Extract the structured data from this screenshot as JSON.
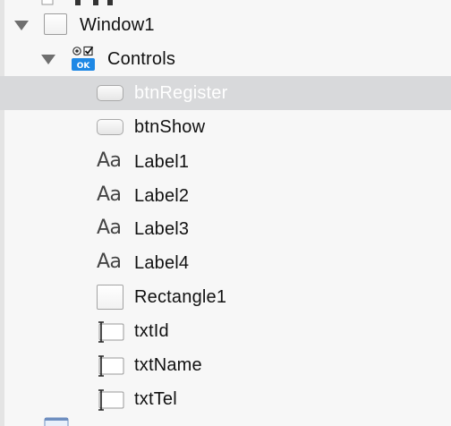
{
  "tree": {
    "rows": [
      {
        "label": "Window1",
        "icon": "window-icon",
        "expanded": true
      },
      {
        "label": "Controls",
        "icon": "controls-icon",
        "expanded": true
      },
      {
        "label": "btnRegister",
        "icon": "button-icon",
        "selected": true
      },
      {
        "label": "btnShow",
        "icon": "button-icon"
      },
      {
        "label": "Label1",
        "icon": "label-aa-icon"
      },
      {
        "label": "Label2",
        "icon": "label-aa-icon"
      },
      {
        "label": "Label3",
        "icon": "label-aa-icon"
      },
      {
        "label": "Label4",
        "icon": "label-aa-icon"
      },
      {
        "label": "Rectangle1",
        "icon": "rectangle-icon"
      },
      {
        "label": "txtId",
        "icon": "textfield-icon"
      },
      {
        "label": "txtName",
        "icon": "textfield-icon"
      },
      {
        "label": "txtTel",
        "icon": "textfield-icon"
      }
    ],
    "icon_glyphs": {
      "label": "Aa",
      "controls_badge": "OK"
    }
  },
  "colors": {
    "selection": "#d8d9db",
    "selected_text": "#ffffff",
    "disclosure": "#6f6f6f",
    "ok_badge": "#1e88e5"
  }
}
